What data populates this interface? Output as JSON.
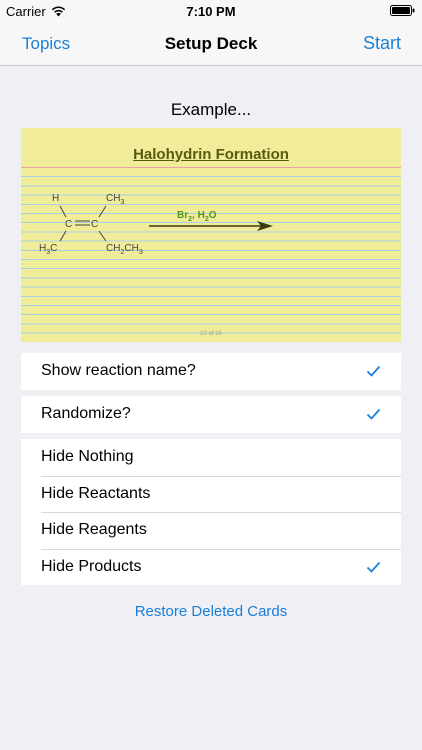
{
  "status_bar": {
    "carrier": "Carrier",
    "time": "7:10 PM"
  },
  "nav": {
    "left": "Topics",
    "title": "Setup Deck",
    "right": "Start"
  },
  "example_label": "Example...",
  "card": {
    "title": "Halohydrin Formation",
    "atoms": {
      "h": "H",
      "c1": "C",
      "c2": "C",
      "ch3_top": "CH",
      "ch3_top_sub": "3",
      "h3c": "H",
      "h3c_sub": "3",
      "h3c_c": "C",
      "ch2ch3_a": "CH",
      "ch2ch3_sub1": "2",
      "ch2ch3_b": "CH",
      "ch2ch3_sub2": "3"
    },
    "reagent": {
      "br": "Br",
      "br_sub": "2",
      "sep": ", H",
      "h2o_sub": "2",
      "o": "O"
    },
    "page": "10 of 16"
  },
  "options_group1": [
    {
      "label": "Show reaction name?",
      "checked": true
    }
  ],
  "options_group2": [
    {
      "label": "Randomize?",
      "checked": true
    }
  ],
  "hide_options": [
    {
      "label": "Hide Nothing",
      "checked": false
    },
    {
      "label": "Hide Reactants",
      "checked": false
    },
    {
      "label": "Hide Reagents",
      "checked": false
    },
    {
      "label": "Hide Products",
      "checked": true
    }
  ],
  "restore_label": "Restore Deleted Cards",
  "colors": {
    "accent": "#1a7fd9",
    "card": "#f1ec9a",
    "title": "#5a5a10",
    "reagent": "#4f9a1a"
  }
}
